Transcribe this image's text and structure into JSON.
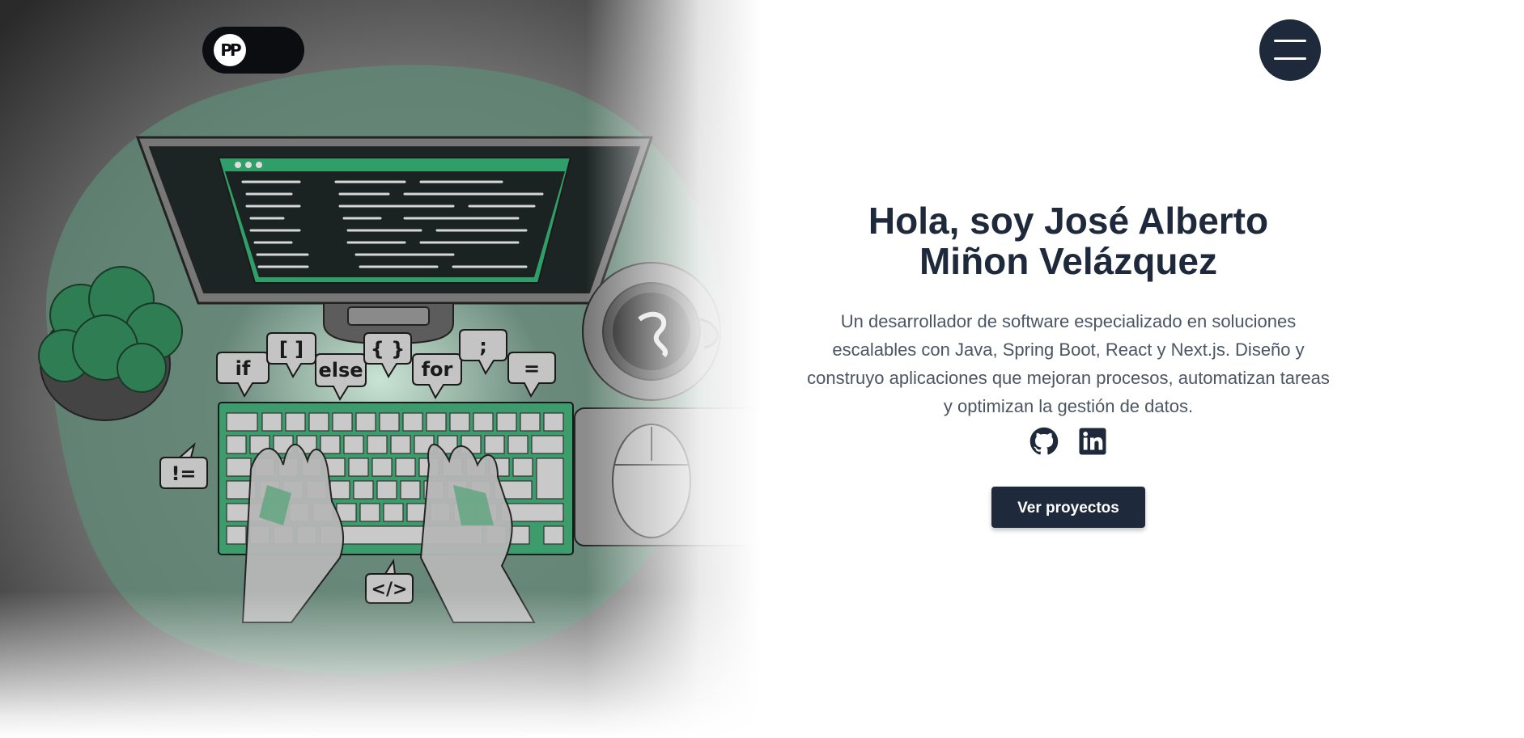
{
  "logo": {
    "initials": "PP"
  },
  "menu": {
    "icon": "hamburger-icon"
  },
  "illustration": {
    "icon": "developer-desk-illustration",
    "bubbles": [
      "if",
      "[ ]",
      "else",
      "{ }",
      "for",
      ";",
      "=",
      "!=",
      "</>"
    ]
  },
  "hero": {
    "title_line1": "Hola, soy José Alberto",
    "title_line2": "Miñon Velázquez",
    "description": "Un desarrollador de software especializado en soluciones escalables con Java, Spring Boot, React y Next.js. Diseño y construyo aplicaciones que mejoran procesos, automatizan tareas y optimizan la gestión de datos.",
    "social": [
      "github-icon",
      "linkedin-icon"
    ],
    "cta_label": "Ver proyectos"
  },
  "colors": {
    "navy": "#1e2a3b",
    "green": "#2f8f5b",
    "text": "#1e293b",
    "muted": "#4b5563"
  }
}
